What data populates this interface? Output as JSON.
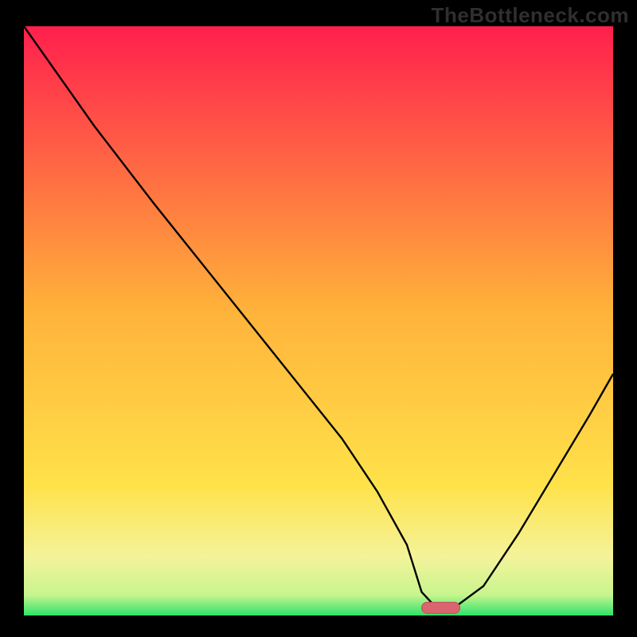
{
  "watermark": "TheBottleneck.com",
  "colors": {
    "frame_bg": "#000000",
    "watermark": "#2f2f2f",
    "grad_top": "#ff1f4d",
    "grad_mid": "#ffd83a",
    "grad_green_light": "#c8f58e",
    "grad_green": "#2ee36a",
    "curve": "#000000",
    "marker_fill": "#d9656f",
    "marker_stroke": "#c24d58"
  },
  "chart_data": {
    "type": "line",
    "title": "",
    "xlabel": "",
    "ylabel": "",
    "xlim": [
      0,
      100
    ],
    "ylim": [
      0,
      100
    ],
    "series": [
      {
        "name": "bottleneck-curve",
        "x": [
          0,
          12,
          22,
          30,
          38,
          46,
          54,
          60,
          65,
          67.5,
          70,
          73,
          78,
          84,
          90,
          96,
          100
        ],
        "values": [
          100,
          83,
          70,
          60,
          50,
          40,
          30,
          21,
          12,
          4,
          1.3,
          1.3,
          5,
          14,
          24,
          34,
          41
        ]
      }
    ],
    "marker": {
      "name": "optimal-range",
      "x_start": 67.5,
      "x_end": 74,
      "y": 1.3
    },
    "background_gradient_stops": [
      {
        "offset": 0.0,
        "color": "#ff1f4d"
      },
      {
        "offset": 0.48,
        "color": "#ffb23a"
      },
      {
        "offset": 0.78,
        "color": "#ffe24a"
      },
      {
        "offset": 0.9,
        "color": "#f4f39a"
      },
      {
        "offset": 0.965,
        "color": "#c8f58e"
      },
      {
        "offset": 1.0,
        "color": "#2ee36a"
      }
    ]
  }
}
